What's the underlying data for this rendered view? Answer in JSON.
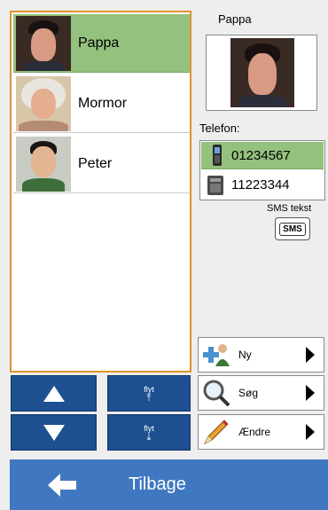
{
  "contacts": [
    {
      "name": "Pappa",
      "selected": true,
      "photo": "man-portrait"
    },
    {
      "name": "Mormor",
      "selected": false,
      "photo": "older-woman-portrait"
    },
    {
      "name": "Peter",
      "selected": false,
      "photo": "boy-portrait"
    }
  ],
  "navigation": {
    "up_icon": "arrow-up-icon",
    "down_icon": "arrow-down-icon",
    "move_up_label": "flyt",
    "move_down_label": "flyt"
  },
  "details": {
    "name": "Pappa",
    "phone_label": "Telefon:",
    "phones": [
      {
        "number": "01234567",
        "type": "mobile-phone-icon",
        "selected": true
      },
      {
        "number": "11223344",
        "type": "desk-phone-icon",
        "selected": false
      }
    ],
    "sms_label": "SMS tekst",
    "sms_icon_text": "SMS"
  },
  "actions": [
    {
      "label": "Ny",
      "icon": "add-person-icon"
    },
    {
      "label": "Søg",
      "icon": "magnifier-icon"
    },
    {
      "label": "Ændre",
      "icon": "pencil-icon"
    }
  ],
  "footer": {
    "back_label": "Tilbage",
    "back_icon": "arrow-left-icon"
  },
  "colors": {
    "selected_green": "#94c17e",
    "nav_blue": "#1d4f91",
    "footer_blue": "#3f78c0",
    "list_border": "#e0922f"
  }
}
